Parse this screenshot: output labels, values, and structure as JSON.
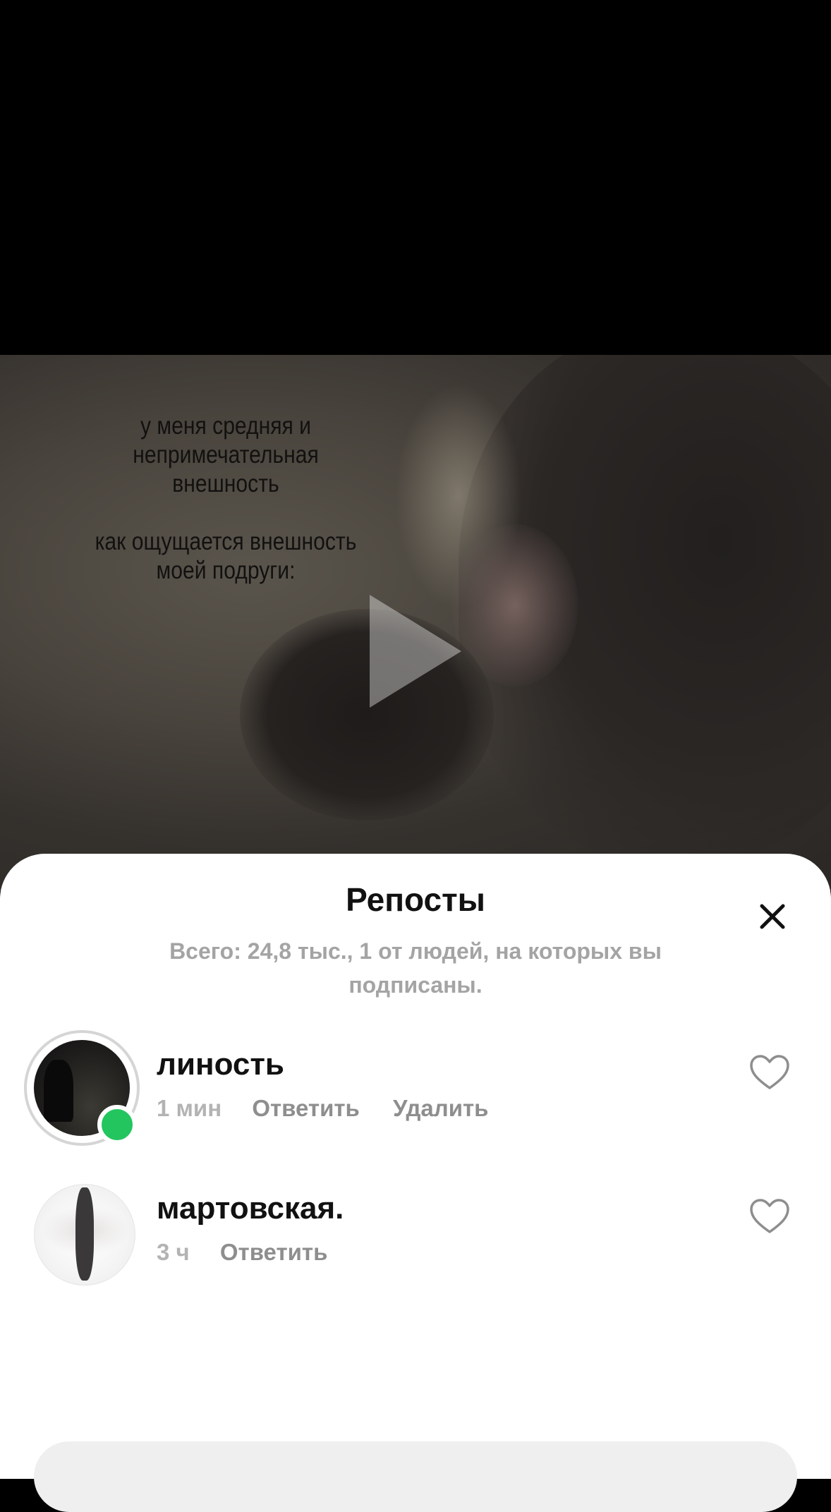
{
  "video": {
    "caption_lines": [
      "у меня средняя и",
      "непримечательная",
      "внешность",
      "как ощущается внешность",
      "моей подруги:"
    ]
  },
  "sheet": {
    "title": "Репосты",
    "summary": "Всего: 24,8 тыс., 1 от людей, на которых вы подписаны."
  },
  "reposts": [
    {
      "username": "линость",
      "time": "1 мин",
      "actions": [
        "Ответить",
        "Удалить"
      ],
      "online": true
    },
    {
      "username": "мартовская.",
      "time": "3 ч",
      "actions": [
        "Ответить"
      ],
      "online": false
    }
  ],
  "colors": {
    "online": "#22c55e",
    "muted": "#8e8e8e",
    "sheet_bg": "#ffffff"
  },
  "icons": [
    "play-icon",
    "close-icon",
    "heart-icon"
  ]
}
